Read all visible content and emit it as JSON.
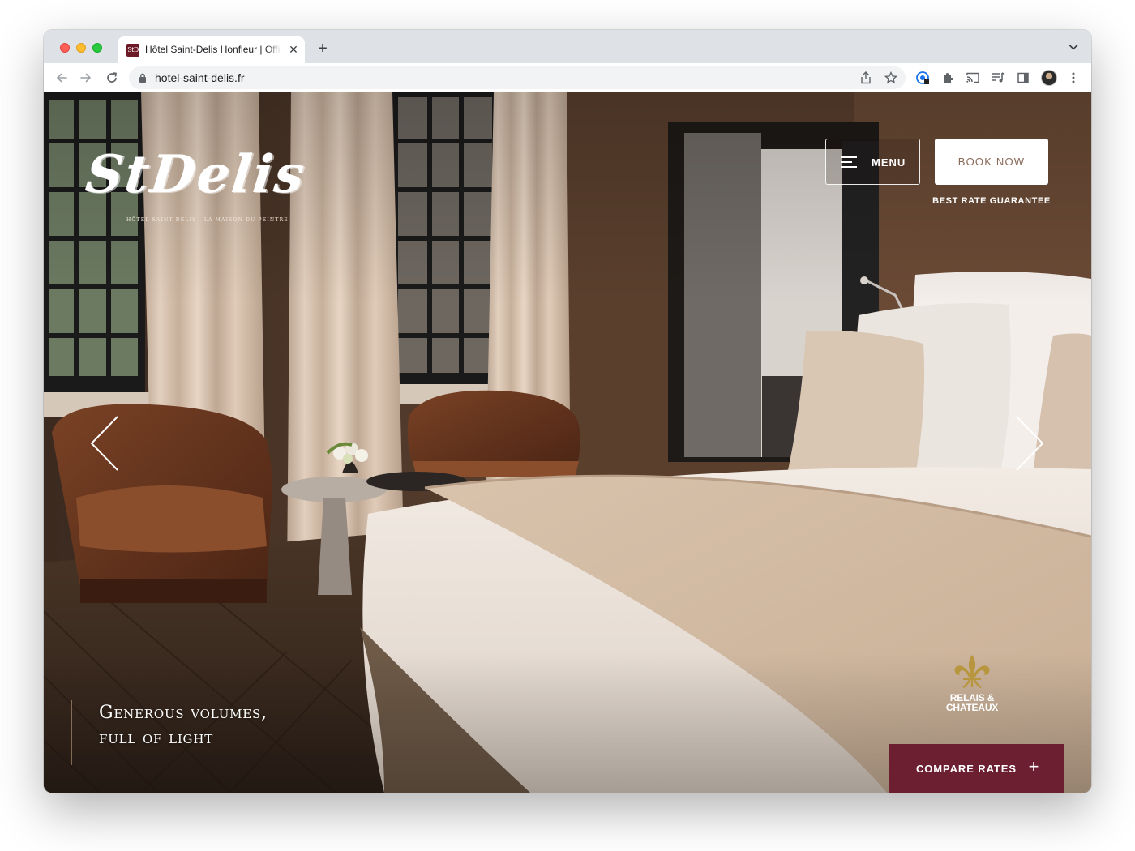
{
  "browser": {
    "tab": {
      "favicon_text": "StD",
      "title": "Hôtel Saint-Delis Honfleur | Official Site",
      "close_glyph": "✕"
    },
    "new_tab_glyph": "+",
    "tab_search_glyph": "⌄",
    "url": "hotel-saint-delis.fr"
  },
  "hero": {
    "logo_text": "StDelis",
    "logo_tagline": "HÔTEL SAINT DELIS - LA MAISON DU PEINTRE",
    "menu_label": "MENU",
    "book_label": "BOOK NOW",
    "best_rate": "BEST RATE GUARANTEE",
    "caption_line1": "Generous volumes,",
    "caption_line2": "full of light",
    "rc_line1": "RELAIS &",
    "rc_line2": "CHATEAUX",
    "compare_label": "COMPARE RATES",
    "compare_plus": "+"
  },
  "colors": {
    "compare_bg": "#6b1f31",
    "book_text": "#8a6a5a",
    "rc_gold": "#b8963e"
  }
}
